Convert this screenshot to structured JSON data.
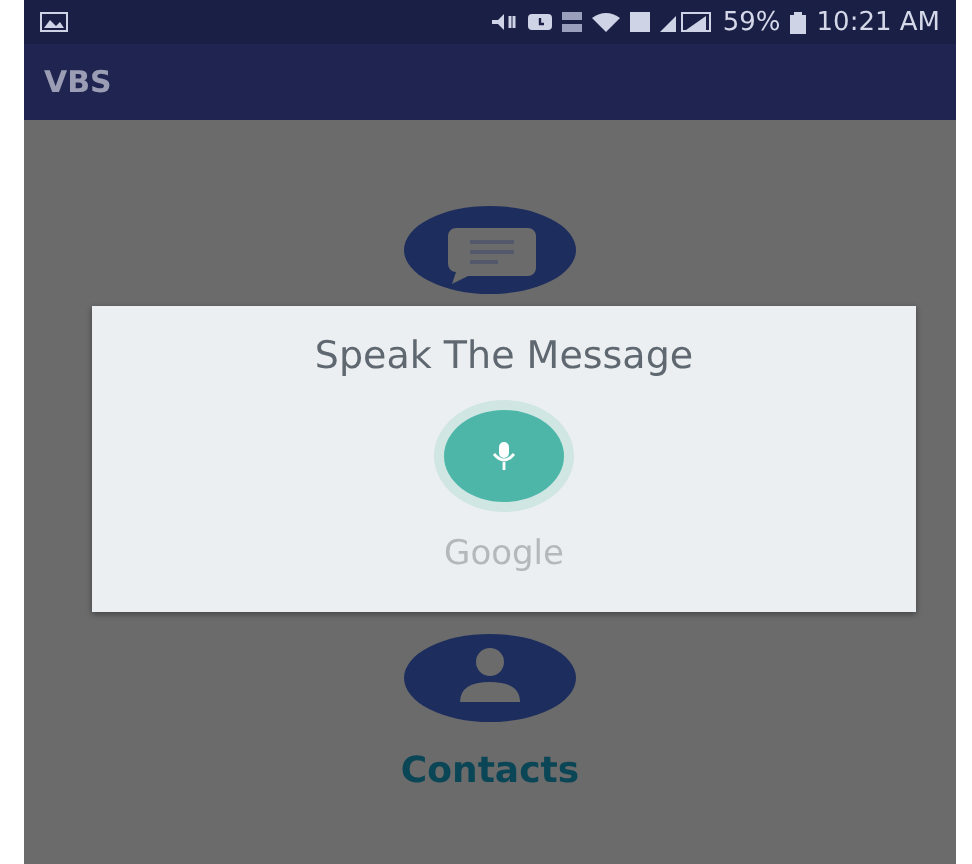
{
  "status_bar": {
    "battery": "59%",
    "time": "10:21 AM"
  },
  "app_bar": {
    "title": "VBS"
  },
  "menu_items": [
    {
      "kind": "message"
    },
    {
      "kind": "contacts",
      "label": "Contacts"
    }
  ],
  "dialog": {
    "title": "Speak The Message",
    "footer": "Google"
  }
}
